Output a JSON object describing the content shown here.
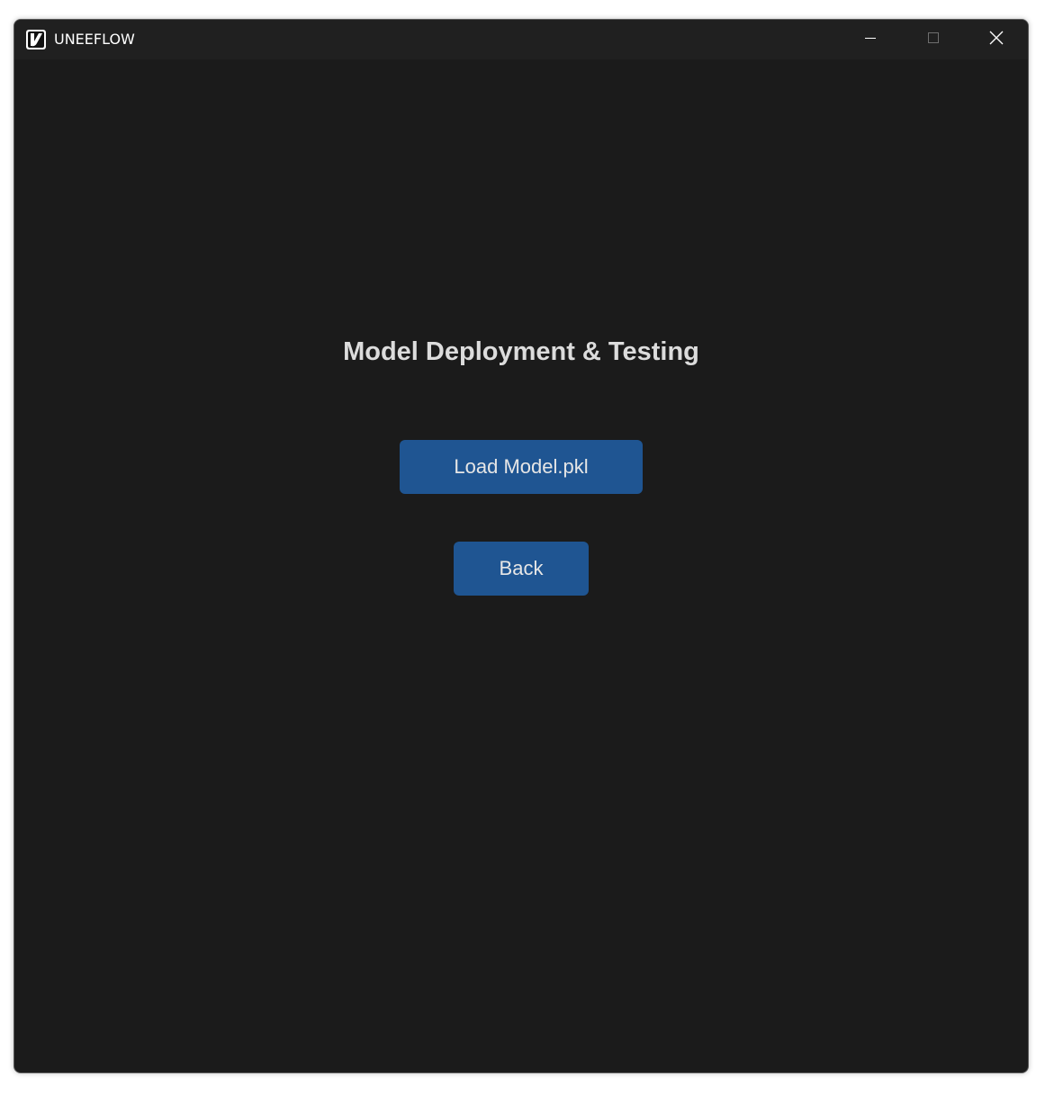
{
  "window": {
    "title": "UNEEFLOW",
    "app_icon": "uneeflow-logo-icon",
    "caption_buttons": [
      "minimize-icon",
      "maximize-icon",
      "close-icon"
    ]
  },
  "main": {
    "heading": "Model Deployment & Testing",
    "load_button_label": "Load Model.pkl",
    "back_button_label": "Back"
  },
  "colors": {
    "background": "#1b1b1b",
    "titlebar": "#202020",
    "button": "#1f5592",
    "heading_text": "#dcdcdc"
  }
}
